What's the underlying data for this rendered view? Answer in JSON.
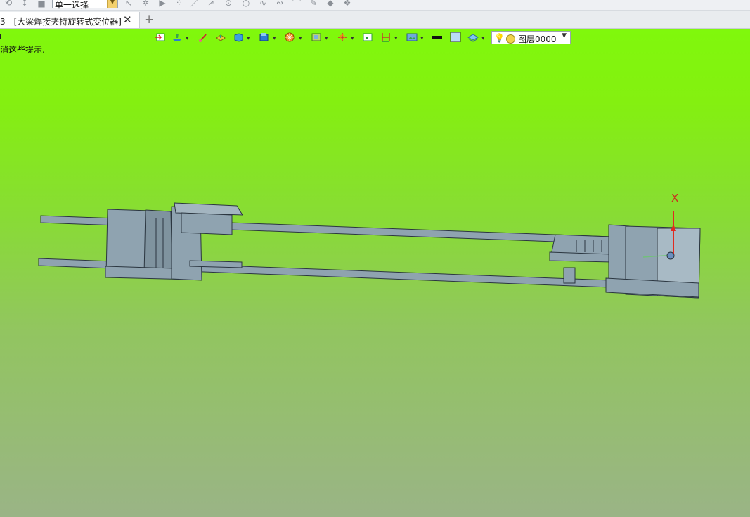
{
  "toolbar": {
    "selection_mode": "单一选择",
    "icons": [
      "rotate-icon",
      "pan-icon",
      "stop-icon",
      "cursor-icon",
      "filter-icon",
      "play-icon",
      "point-icon",
      "line-icon",
      "arrow-line-icon",
      "circle-point-icon",
      "circle-icon",
      "curve-icon",
      "spline-icon",
      "arc-icon",
      "pen-icon",
      "shape-icon",
      "layer-stack-icon"
    ]
  },
  "tabs": {
    "document_title": "3 - [大梁焊接夹持旋转式变位器]",
    "close_symbol": "✕",
    "add_symbol": "+"
  },
  "viewport": {
    "hint_line1": "",
    "hint_line2": "消这些提示.",
    "background_top": "#80f80c",
    "background_bottom": "#9ab486",
    "toolbar_icons": [
      "exit-sketch-icon",
      "layer-filter-icon",
      "brush-icon",
      "face-color-icon",
      "solid-display-icon",
      "view-cube-icon",
      "render-wheel-icon",
      "clip-plane-icon",
      "coordinate-icon",
      "point-snap-icon",
      "measure-icon",
      "image-view-icon",
      "line-color-swatch",
      "fill-color-swatch",
      "layer-display-icon"
    ],
    "layer": {
      "name": "图层0000"
    },
    "axis_label": "X"
  }
}
